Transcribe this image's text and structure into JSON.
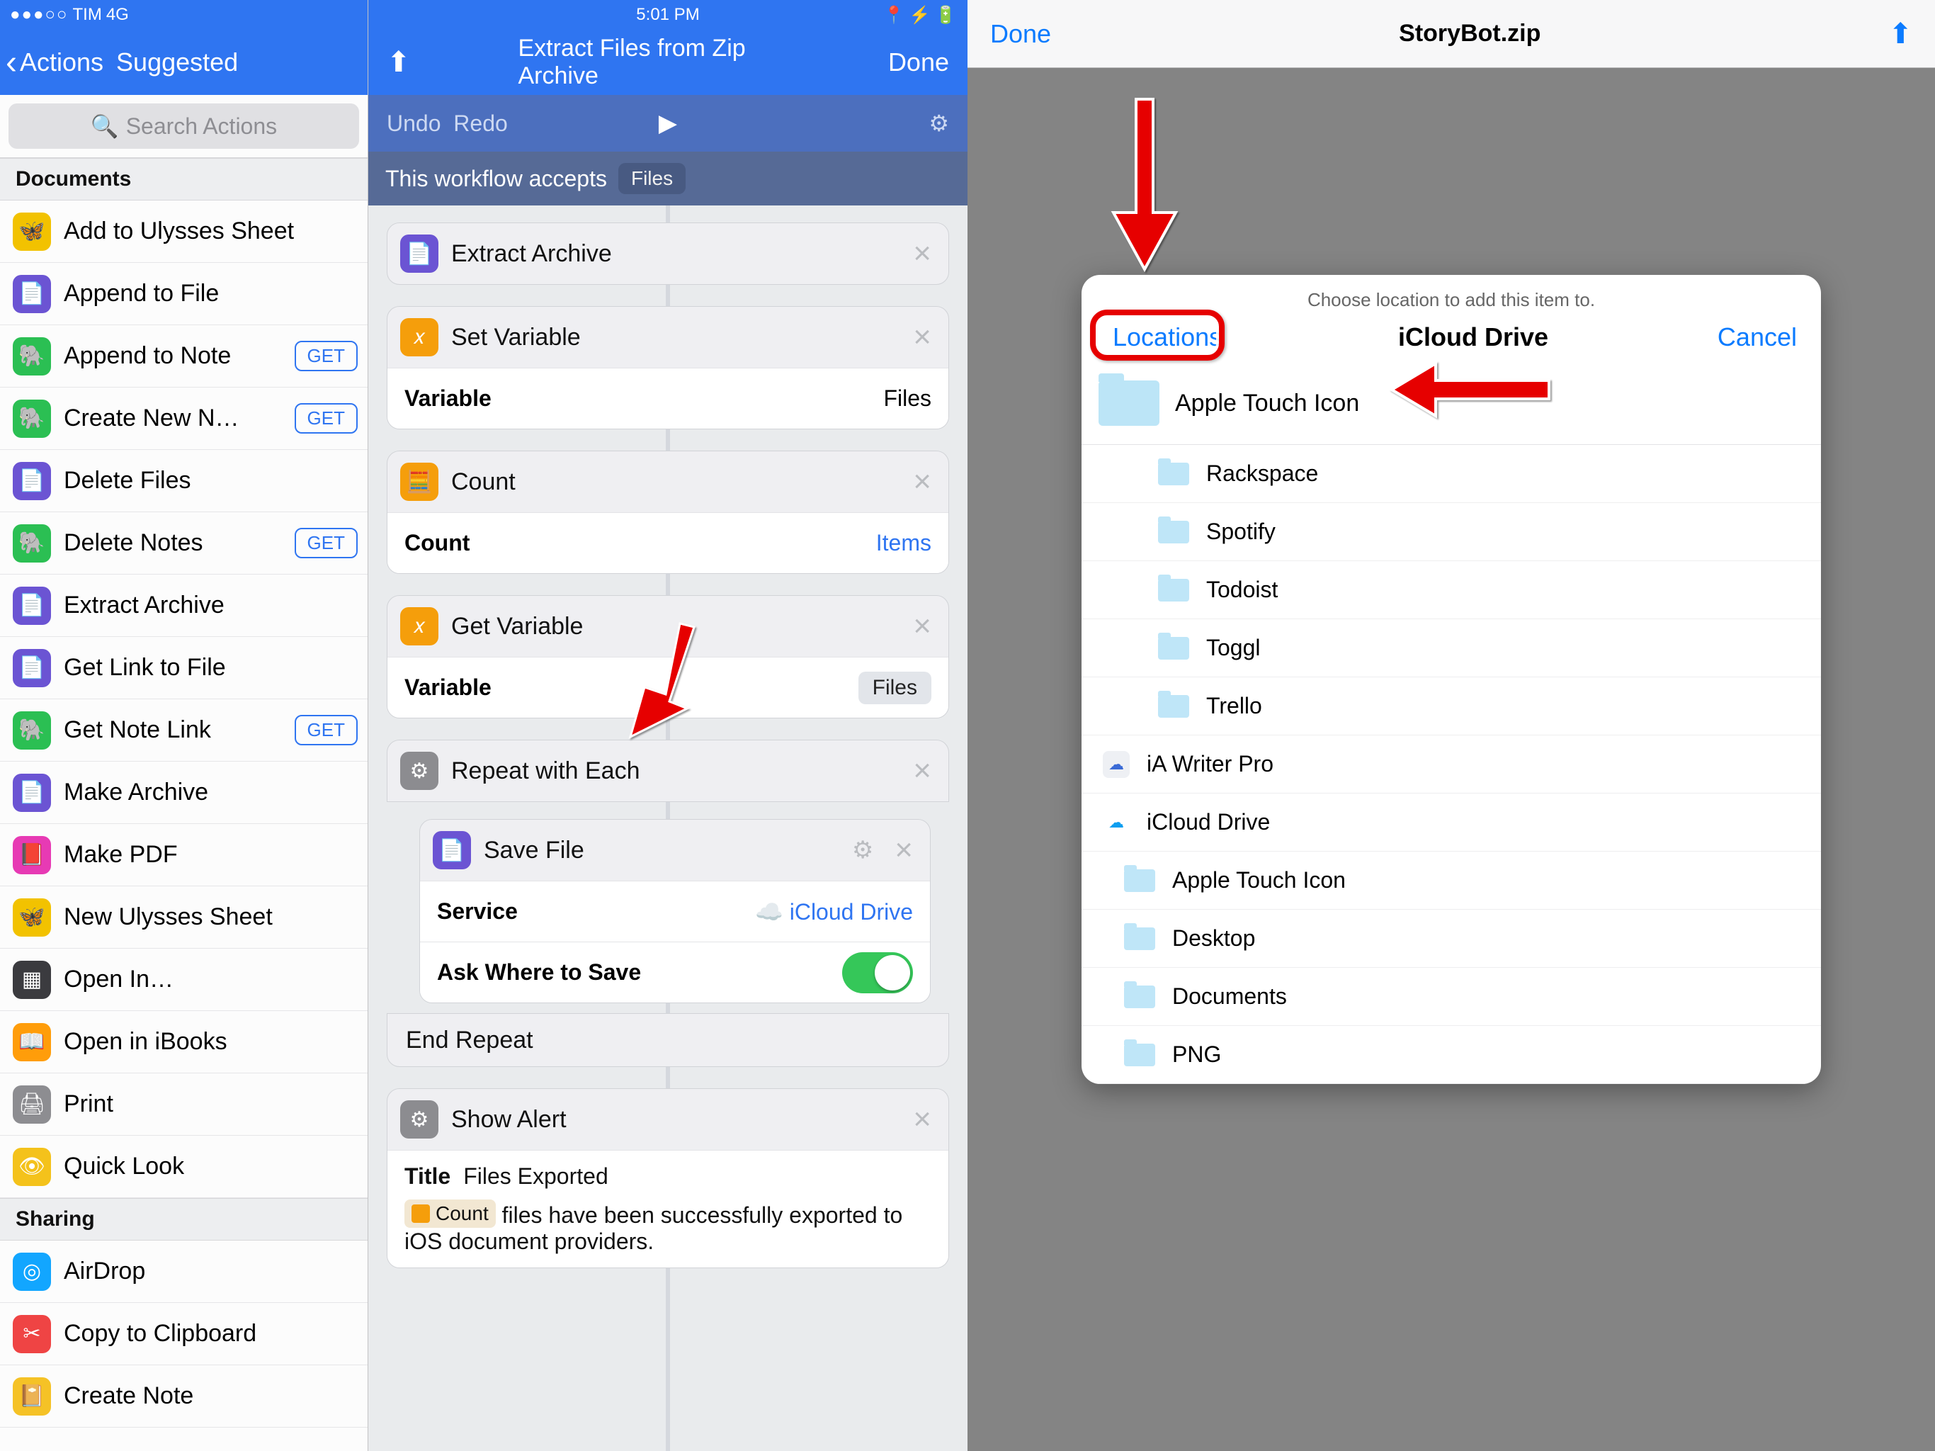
{
  "left": {
    "status": {
      "carrier": "TIM",
      "network": "4G",
      "time": "5:01 PM"
    },
    "nav": {
      "back1": "Actions",
      "back2": "Suggested"
    },
    "search_placeholder": "Search Actions",
    "sections": [
      {
        "title": "Documents",
        "items": [
          {
            "label": "Add to Ulysses Sheet",
            "color": "#f2c200",
            "glyph": "🦋"
          },
          {
            "label": "Append to File",
            "color": "#6b54d3",
            "glyph": "📄"
          },
          {
            "label": "Append to Note",
            "color": "#2bbf53",
            "glyph": "🐘",
            "get": true
          },
          {
            "label": "Create New N…",
            "color": "#2bbf53",
            "glyph": "🐘",
            "get": true
          },
          {
            "label": "Delete Files",
            "color": "#6b54d3",
            "glyph": "📄"
          },
          {
            "label": "Delete Notes",
            "color": "#2bbf53",
            "glyph": "🐘",
            "get": true
          },
          {
            "label": "Extract Archive",
            "color": "#6b54d3",
            "glyph": "📄"
          },
          {
            "label": "Get Link to File",
            "color": "#6b54d3",
            "glyph": "📄"
          },
          {
            "label": "Get Note Link",
            "color": "#2bbf53",
            "glyph": "🐘",
            "get": true
          },
          {
            "label": "Make Archive",
            "color": "#6b54d3",
            "glyph": "📄"
          },
          {
            "label": "Make PDF",
            "color": "#e73ab4",
            "glyph": "📕"
          },
          {
            "label": "New Ulysses Sheet",
            "color": "#f2c200",
            "glyph": "🦋"
          },
          {
            "label": "Open In…",
            "color": "#3b3b3f",
            "glyph": "▦"
          },
          {
            "label": "Open in iBooks",
            "color": "#ff9d0a",
            "glyph": "📖"
          },
          {
            "label": "Print",
            "color": "#8d8d91",
            "glyph": "🖨"
          },
          {
            "label": "Quick Look",
            "color": "#f4c21b",
            "glyph": "👁"
          }
        ]
      },
      {
        "title": "Sharing",
        "items": [
          {
            "label": "AirDrop",
            "color": "#12a6ff",
            "glyph": "◎"
          },
          {
            "label": "Copy to Clipboard",
            "color": "#ef4444",
            "glyph": "✂"
          },
          {
            "label": "Create Note",
            "color": "#f5c226",
            "glyph": "📔"
          }
        ]
      }
    ]
  },
  "workflow": {
    "title": "Extract Files from Zip Archive",
    "done": "Done",
    "share": "Share",
    "undo": "Undo",
    "redo": "Redo",
    "accepts_text": "This workflow accepts",
    "accepts_pill": "Files",
    "steps": {
      "extract": {
        "title": "Extract Archive"
      },
      "setvar": {
        "title": "Set Variable",
        "key": "Variable",
        "value": "Files"
      },
      "count": {
        "title": "Count",
        "key": "Count",
        "value": "Items"
      },
      "getvar": {
        "title": "Get Variable",
        "key": "Variable",
        "value": "Files"
      },
      "repeat": {
        "title": "Repeat with Each",
        "end": "End Repeat"
      },
      "savefile": {
        "title": "Save File",
        "service_k": "Service",
        "service_v": "iCloud Drive",
        "ask_k": "Ask Where to Save"
      },
      "alert": {
        "title": "Show Alert",
        "title_k": "Title",
        "title_v": "Files Exported",
        "token": "Count",
        "body": "files have been successfully exported to iOS document providers."
      }
    }
  },
  "right": {
    "done": "Done",
    "filename": "StoryBot.zip",
    "modal": {
      "hint": "Choose location to add this item to.",
      "locations": "Locations",
      "title": "iCloud Drive",
      "cancel": "Cancel",
      "current": "Apple Touch Icon",
      "subfolders": [
        "Rackspace",
        "Spotify",
        "Todoist",
        "Toggl",
        "Trello"
      ],
      "apps": [
        {
          "label": "iA Writer Pro",
          "color": "#eef0f4",
          "ink": "#3a6ad6"
        },
        {
          "label": "iCloud Drive",
          "color": "#ffffff",
          "ink": "#0b9ef0"
        }
      ],
      "drive_folders": [
        "Apple Touch Icon",
        "Desktop",
        "Documents",
        "PNG"
      ]
    }
  },
  "labels": {
    "get": "GET"
  }
}
